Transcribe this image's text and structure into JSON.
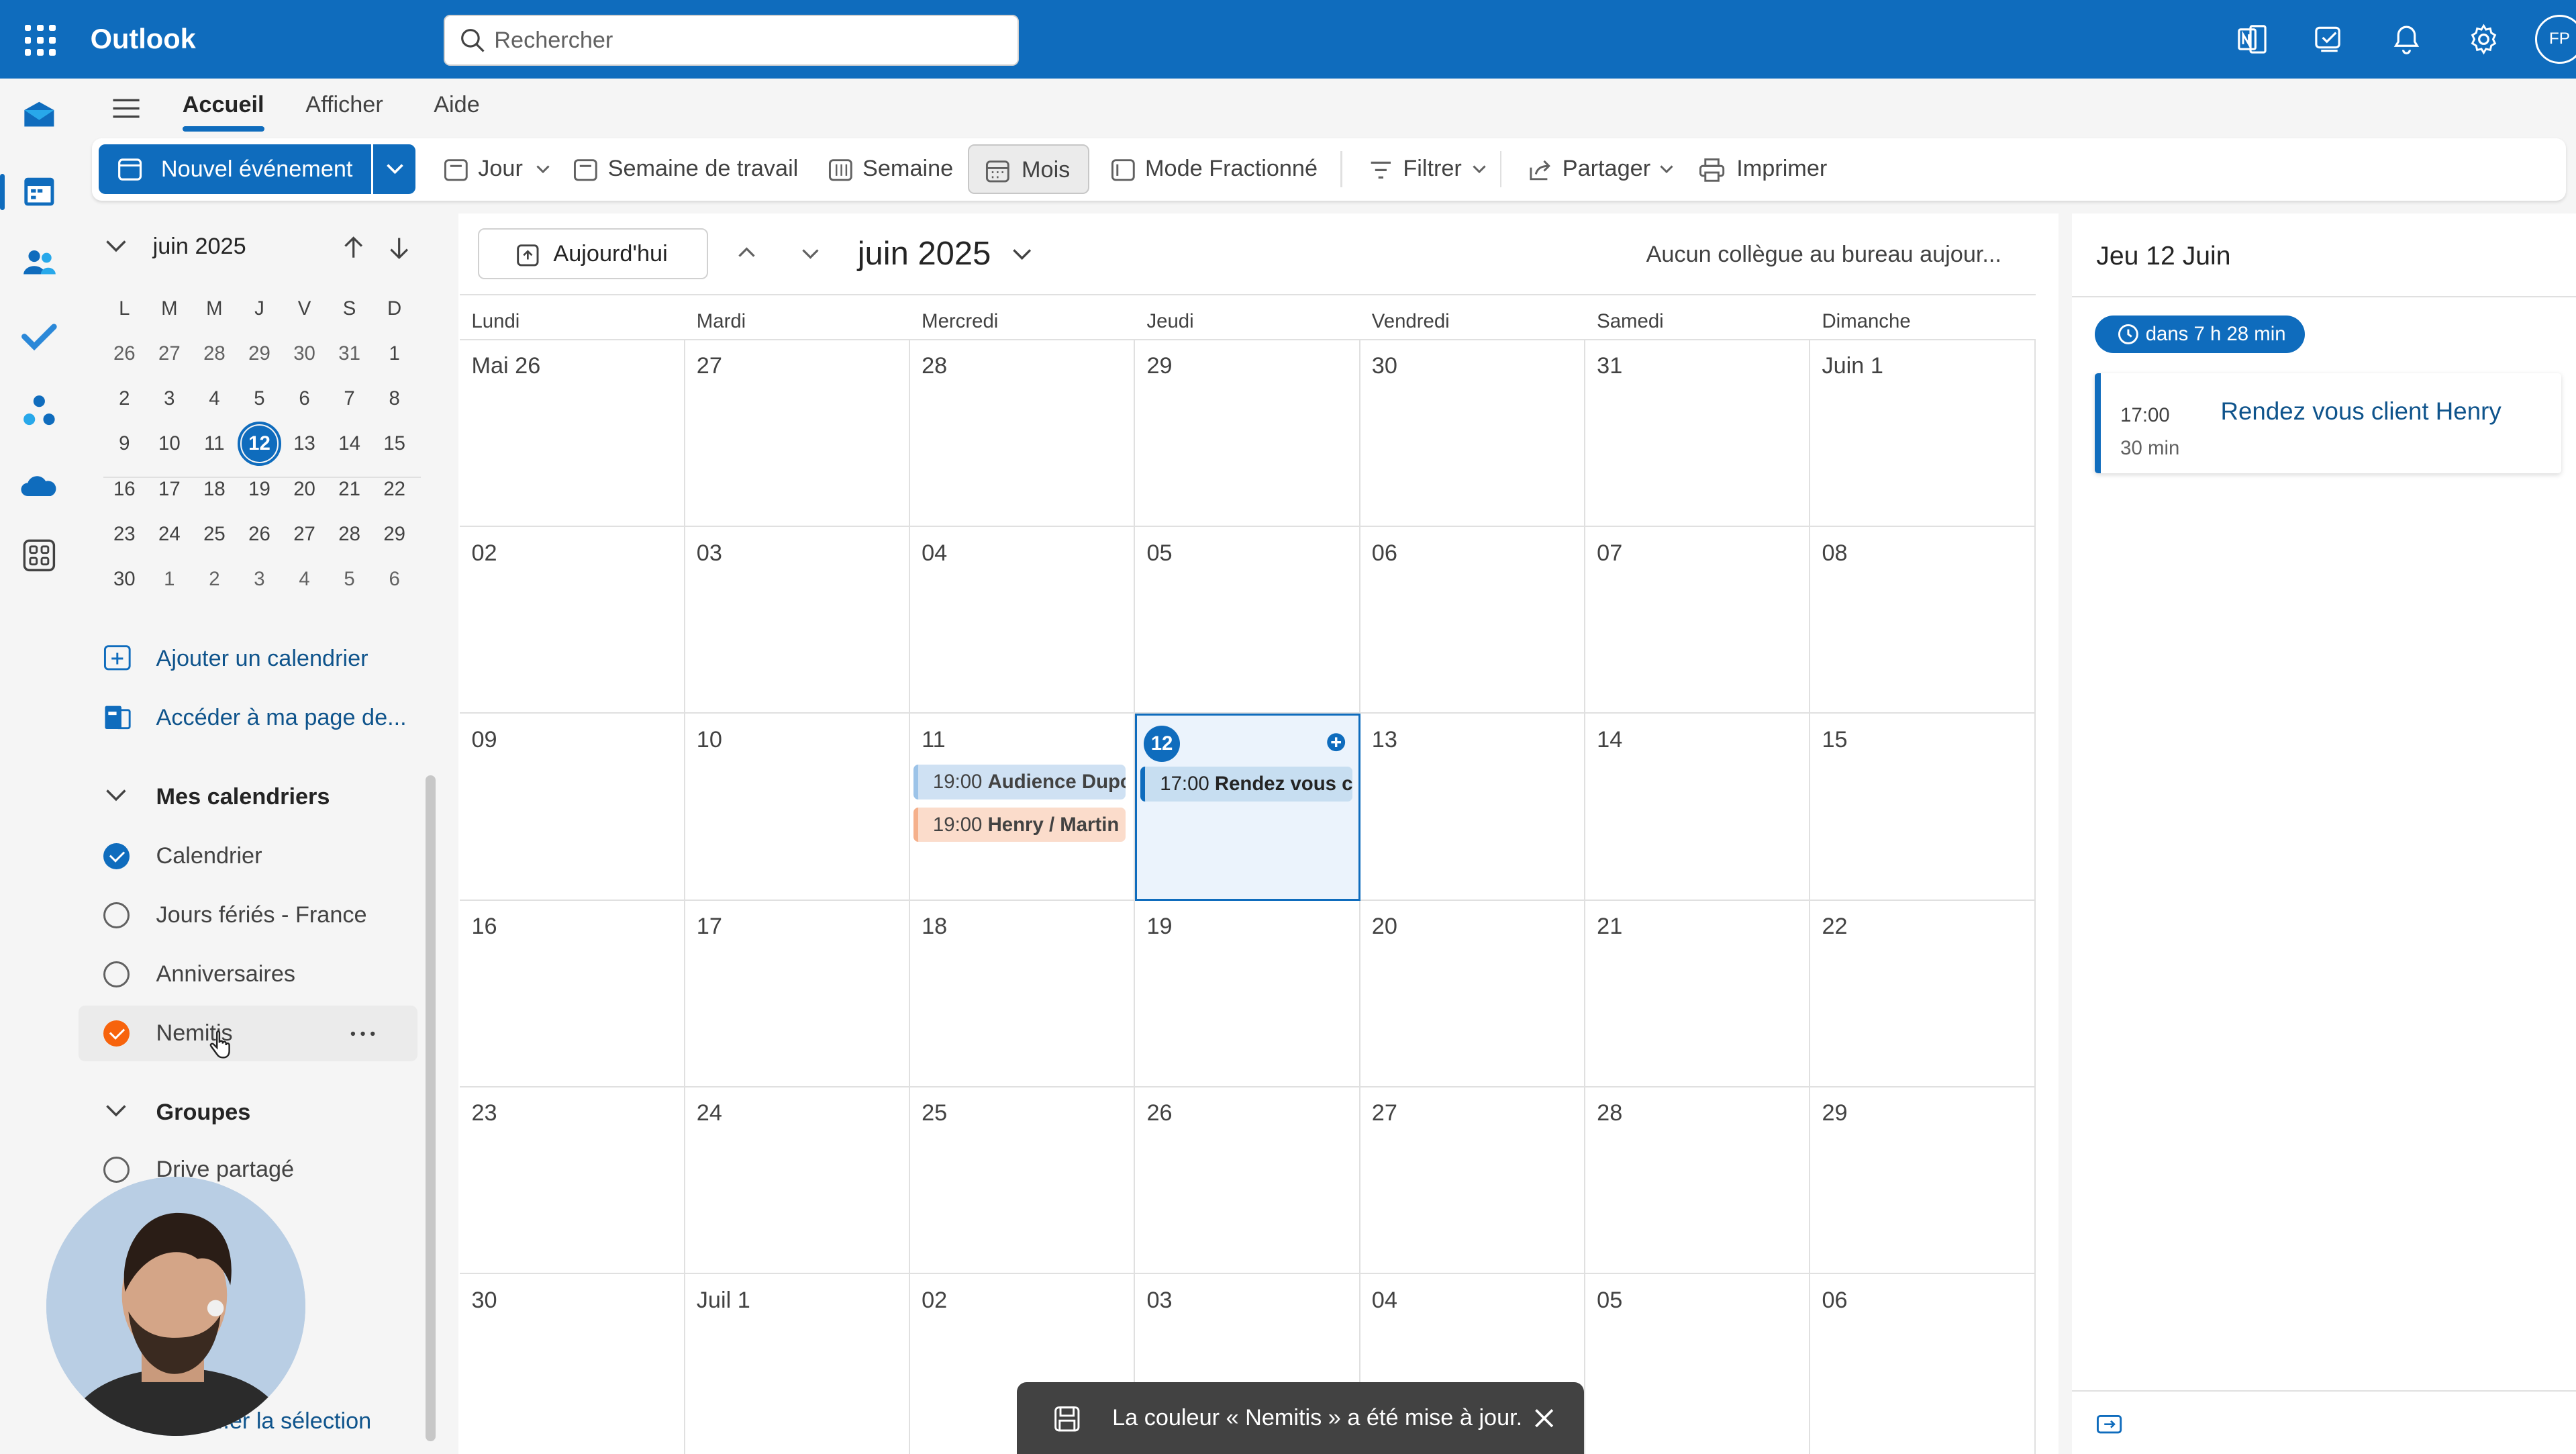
{
  "app": {
    "title": "Outlook"
  },
  "search": {
    "placeholder": "Rechercher"
  },
  "user": {
    "initials": "FP"
  },
  "ribbon": {
    "tabs": [
      "Accueil",
      "Afficher",
      "Aide"
    ]
  },
  "toolbar": {
    "new_event": "Nouvel événement",
    "day": "Jour",
    "work_week": "Semaine de travail",
    "week": "Semaine",
    "month": "Mois",
    "split": "Mode Fractionné",
    "filter": "Filtrer",
    "share": "Partager",
    "print": "Imprimer"
  },
  "mini": {
    "title": "juin 2025",
    "dow": [
      "L",
      "M",
      "M",
      "J",
      "V",
      "S",
      "D"
    ],
    "weeks": [
      [
        "26",
        "27",
        "28",
        "29",
        "30",
        "31",
        "1"
      ],
      [
        "2",
        "3",
        "4",
        "5",
        "6",
        "7",
        "8"
      ],
      [
        "9",
        "10",
        "11",
        "12",
        "13",
        "14",
        "15"
      ],
      [
        "16",
        "17",
        "18",
        "19",
        "20",
        "21",
        "22"
      ],
      [
        "23",
        "24",
        "25",
        "26",
        "27",
        "28",
        "29"
      ],
      [
        "30",
        "1",
        "2",
        "3",
        "4",
        "5",
        "6"
      ]
    ],
    "today": "12"
  },
  "left": {
    "add_calendar": "Ajouter un calendrier",
    "my_page": "Accéder à ma page de...",
    "my_cals": "Mes calendriers",
    "groups": "Groupes",
    "footer": "...er la sélection"
  },
  "calendars": [
    {
      "name": "Calendrier",
      "checked": true,
      "color": "#0f6cbd"
    },
    {
      "name": "Jours fériés - France",
      "checked": false
    },
    {
      "name": "Anniversaires",
      "checked": false
    },
    {
      "name": "Nemitis",
      "checked": true,
      "color": "#f7630c"
    }
  ],
  "groups": [
    {
      "name": "Drive partagé",
      "checked": false
    }
  ],
  "calendar": {
    "today_btn": "Aujourd'hui",
    "title": "juin 2025",
    "coworkers": "Aucun collègue au bureau aujour...",
    "weekdays": [
      "Lundi",
      "Mardi",
      "Mercredi",
      "Jeudi",
      "Vendredi",
      "Samedi",
      "Dimanche"
    ],
    "weeks": [
      [
        "Mai 26",
        "27",
        "28",
        "29",
        "30",
        "31",
        "Juin 1"
      ],
      [
        "02",
        "03",
        "04",
        "05",
        "06",
        "07",
        "08"
      ],
      [
        "09",
        "10",
        "11",
        "12",
        "13",
        "14",
        "15"
      ],
      [
        "16",
        "17",
        "18",
        "19",
        "20",
        "21",
        "22"
      ],
      [
        "23",
        "24",
        "25",
        "26",
        "27",
        "28",
        "29"
      ],
      [
        "30",
        "Juil 1",
        "02",
        "03",
        "04",
        "05",
        "06"
      ]
    ],
    "events": [
      {
        "week": 2,
        "day": 2,
        "slot": 0,
        "time": "19:00",
        "title": "Audience Dupo",
        "style": "lblue"
      },
      {
        "week": 2,
        "day": 2,
        "slot": 1,
        "time": "19:00",
        "title": "Henry / Martin",
        "style": "orange"
      },
      {
        "week": 2,
        "day": 3,
        "slot": 0,
        "time": "17:00",
        "title": "Rendez vous cli",
        "style": "blue"
      }
    ]
  },
  "agenda": {
    "date": "Jeu 12 Juin",
    "countdown": "dans 7 h 28 min",
    "event": {
      "time": "17:00",
      "duration": "30 min",
      "title": "Rendez vous client Henry"
    }
  },
  "toast": {
    "message": "La couleur « Nemitis » a été mise à jour."
  },
  "colors": {
    "brand": "#0f6cbd",
    "nemitis": "#f7630c"
  }
}
